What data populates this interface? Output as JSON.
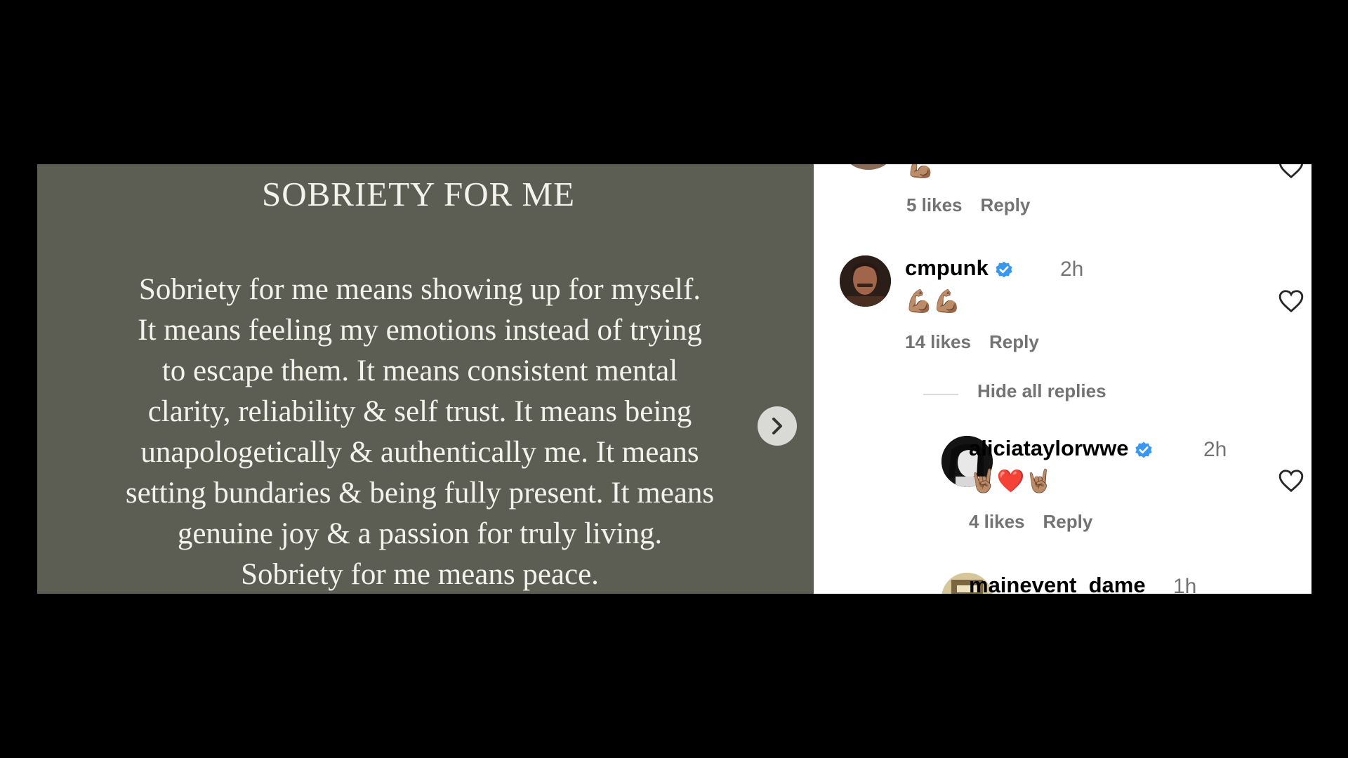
{
  "post": {
    "title": "SOBRIETY FOR ME",
    "body_lines": [
      "Sobriety for me means showing up for myself.",
      "It means feeling my emotions instead of trying",
      "to escape them. It means consistent mental",
      "clarity, reliability & self trust. It means being",
      "unapologetically & authentically me. It means",
      "setting bundaries & being fully present. It means",
      "genuine joy & a passion for truly living.",
      "Sobriety for me means peace."
    ]
  },
  "comments": {
    "partial_top": {
      "emoji": "💪🏽",
      "likes": "5 likes",
      "reply": "Reply"
    },
    "cmpunk": {
      "username": "cmpunk",
      "time": "2h",
      "emoji": "💪🏽💪🏽",
      "likes": "14 likes",
      "reply": "Reply"
    },
    "hide_replies": "Hide all replies",
    "aliciataylorwwe": {
      "username": "aliciataylorwwe",
      "time": "2h",
      "emoji": "🤘🏽❤️🤘🏽",
      "likes": "4 likes",
      "reply": "Reply"
    },
    "mainevent": {
      "username": "mainevent_dame",
      "time": "1h"
    }
  },
  "colors": {
    "image_bg": "#5c5e53",
    "verified": "#3897f0",
    "muted_text": "#737373"
  }
}
